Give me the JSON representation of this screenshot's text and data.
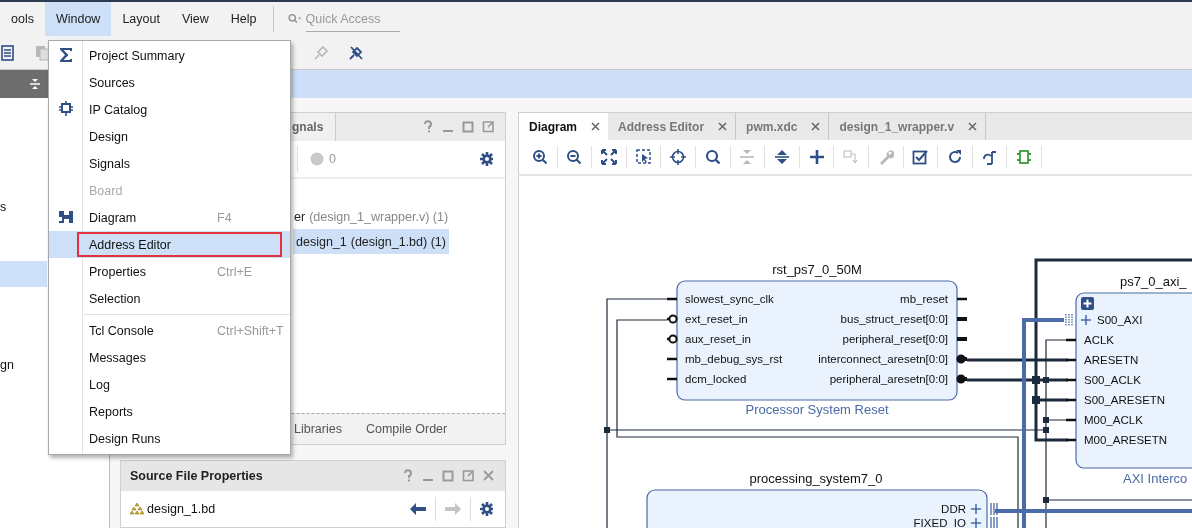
{
  "menubar": {
    "items": [
      {
        "label": "ools",
        "selected": false
      },
      {
        "label": "Window",
        "selected": true
      },
      {
        "label": "Layout",
        "selected": false
      },
      {
        "label": "View",
        "selected": false
      },
      {
        "label": "Help",
        "selected": false
      }
    ],
    "search": {
      "placeholder": "Quick Access"
    }
  },
  "toolbar": {
    "buttons": [
      {
        "kind": "document",
        "disabled": false
      },
      {
        "kind": "copy",
        "disabled": true
      },
      {
        "kind": "plug",
        "disabled": true
      },
      {
        "kind": "unplug",
        "disabled": false
      }
    ]
  },
  "left_panel": {
    "rows": [
      {
        "label": "s",
        "selected": false
      },
      {
        "selected": true
      },
      {
        "label": "gn",
        "selected": false
      }
    ]
  },
  "window_menu": {
    "groups": [
      [
        {
          "label": "Project Summary",
          "kind": "summary",
          "selected": false,
          "disabled": false,
          "highlighted": false
        },
        {
          "label": "Sources",
          "kind": "plain",
          "selected": false,
          "disabled": false,
          "highlighted": false
        },
        {
          "label": "IP Catalog",
          "kind": "catalog",
          "selected": false,
          "disabled": false,
          "highlighted": false
        },
        {
          "label": "Design",
          "kind": "plain",
          "selected": false,
          "disabled": false,
          "highlighted": false
        },
        {
          "label": "Signals",
          "kind": "plain",
          "selected": false,
          "disabled": false,
          "highlighted": false
        },
        {
          "label": "Board",
          "kind": "plain",
          "selected": false,
          "disabled": true,
          "highlighted": false
        },
        {
          "label": "Diagram",
          "kind": "diagram",
          "shortcut": "F4",
          "selected": false,
          "disabled": false,
          "highlighted": false
        },
        {
          "label": "Address Editor",
          "kind": "plain",
          "selected": true,
          "disabled": false,
          "highlighted": true
        },
        {
          "label": "Properties",
          "kind": "plain",
          "shortcut": "Ctrl+E",
          "selected": false,
          "disabled": false,
          "highlighted": false
        },
        {
          "label": "Selection",
          "kind": "plain",
          "selected": false,
          "disabled": false,
          "highlighted": false
        }
      ],
      [
        {
          "label": "Tcl Console",
          "kind": "plain",
          "shortcut": "Ctrl+Shift+T",
          "selected": false,
          "disabled": false,
          "highlighted": false
        },
        {
          "label": "Messages",
          "kind": "plain",
          "selected": false,
          "disabled": false,
          "highlighted": false
        },
        {
          "label": "Log",
          "kind": "plain",
          "selected": false,
          "disabled": false,
          "highlighted": false
        },
        {
          "label": "Reports",
          "kind": "plain",
          "selected": false,
          "disabled": false,
          "highlighted": false
        },
        {
          "label": "Design Runs",
          "kind": "plain",
          "selected": false,
          "disabled": false,
          "highlighted": false
        }
      ]
    ]
  },
  "sources_panel": {
    "tab": "gnals",
    "warning_count": "0",
    "tree": [
      {
        "name": "er",
        "detail": "(design_1_wrapper.v) (1)",
        "selected": false,
        "children": [
          {
            "name": "design_1",
            "detail": "(design_1.bd) (1)",
            "selected": true
          }
        ]
      }
    ],
    "bottom_tabs": [
      {
        "label": "Libraries",
        "selected": false
      },
      {
        "label": "Compile Order",
        "selected": false
      }
    ]
  },
  "properties_panel": {
    "title": "Source File Properties",
    "file": "design_1.bd",
    "back_disabled": false,
    "forward_disabled": true
  },
  "diagram": {
    "tabs": [
      {
        "label": "Diagram",
        "selected": true
      },
      {
        "label": "Address Editor",
        "selected": false
      },
      {
        "label": "pwm.xdc",
        "selected": false
      },
      {
        "label": "design_1_wrapper.v",
        "selected": false
      }
    ],
    "toolbar": [
      {
        "kind": "zoom-in",
        "disabled": false
      },
      {
        "kind": "zoom-out",
        "disabled": false
      },
      {
        "kind": "fit",
        "disabled": false
      },
      {
        "kind": "select-area",
        "disabled": false
      },
      {
        "kind": "target",
        "disabled": false
      },
      {
        "kind": "search",
        "disabled": false
      },
      {
        "kind": "collapse",
        "disabled": true
      },
      {
        "kind": "expand",
        "disabled": false
      },
      {
        "kind": "add",
        "disabled": false
      },
      {
        "kind": "route",
        "disabled": true
      },
      {
        "kind": "wrench",
        "disabled": true
      },
      {
        "kind": "validate",
        "disabled": false
      },
      {
        "kind": "refresh",
        "disabled": false
      },
      {
        "kind": "regenerate",
        "disabled": false
      },
      {
        "kind": "ip",
        "disabled": false
      }
    ],
    "blocks": [
      {
        "kind": "reset",
        "title": "rst_ps7_0_50M",
        "subtitle": "Processor System Reset",
        "left_ports": [
          {
            "name": "slowest_sync_clk",
            "kind": "pin",
            "active_low": false
          },
          {
            "name": "ext_reset_in",
            "kind": "pin",
            "active_low": true
          },
          {
            "name": "aux_reset_in",
            "kind": "pin",
            "active_low": true
          },
          {
            "name": "mb_debug_sys_rst",
            "kind": "pin",
            "active_low": false
          },
          {
            "name": "dcm_locked",
            "kind": "pin",
            "active_low": false
          }
        ],
        "right_ports": [
          {
            "name": "mb_reset",
            "kind": "pin",
            "active_low": false
          },
          {
            "name": "bus_struct_reset[0:0]",
            "kind": "bus",
            "active_low": false
          },
          {
            "name": "peripheral_reset[0:0]",
            "kind": "bus",
            "active_low": false
          },
          {
            "name": "interconnect_aresetn[0:0]",
            "kind": "bus",
            "active_low": true
          },
          {
            "name": "peripheral_aresetn[0:0]",
            "kind": "bus",
            "active_low": true
          }
        ]
      },
      {
        "kind": "interconnect",
        "title": "ps7_0_axi_",
        "subtitle": "AXI Interco",
        "left_ports": [
          {
            "name": "S00_AXI",
            "kind": "interface",
            "active_low": false
          },
          {
            "name": "ACLK",
            "kind": "pin",
            "active_low": false
          },
          {
            "name": "ARESETN",
            "kind": "pin",
            "active_low": false
          },
          {
            "name": "S00_ACLK",
            "kind": "pin",
            "active_low": false
          },
          {
            "name": "S00_ARESETN",
            "kind": "pin",
            "active_low": false
          },
          {
            "name": "M00_ACLK",
            "kind": "pin",
            "active_low": false
          },
          {
            "name": "M00_ARESETN",
            "kind": "pin",
            "active_low": false
          }
        ]
      },
      {
        "kind": "ps",
        "title": "processing_system7_0",
        "right_ports": [
          {
            "name": "DDR",
            "kind": "interface",
            "active_low": false
          },
          {
            "name": "FIXED_IO",
            "kind": "interface",
            "active_low": false
          }
        ]
      }
    ]
  }
}
